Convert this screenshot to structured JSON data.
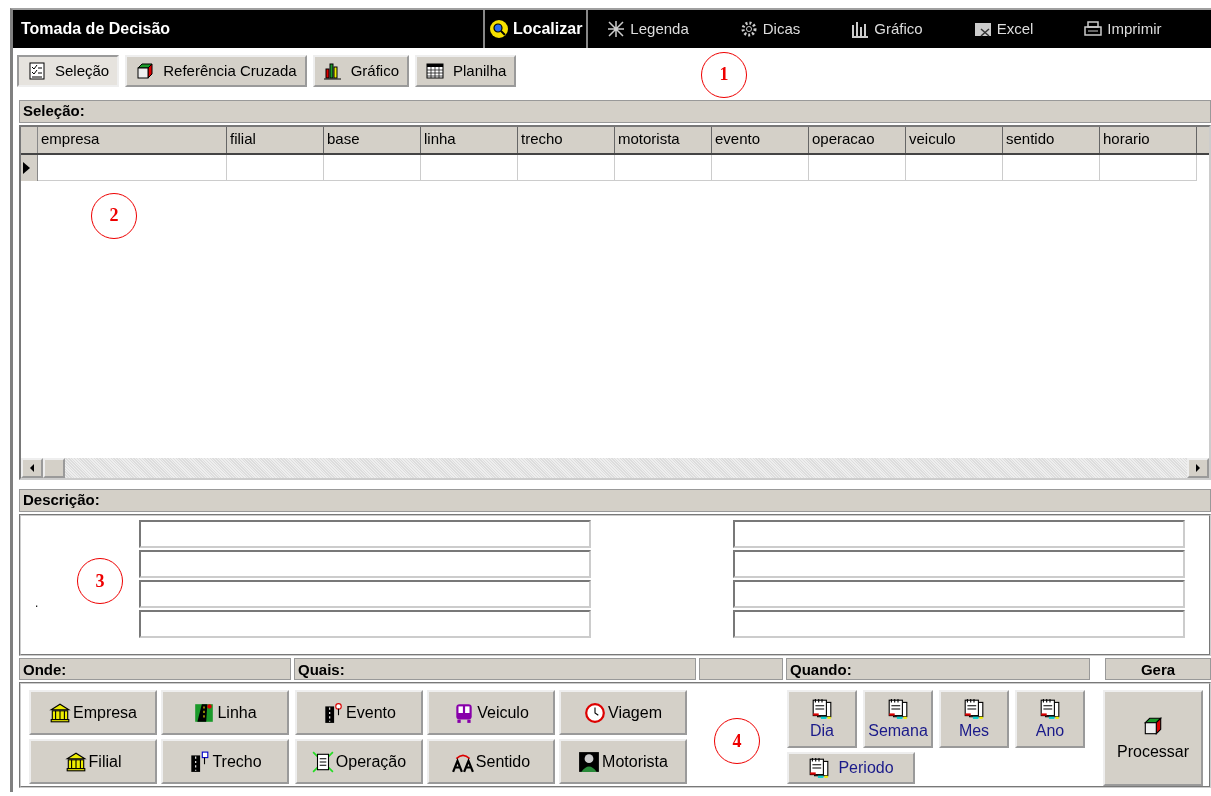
{
  "window": {
    "title": "Tomada de Decisão"
  },
  "search_button": {
    "label": "Localizar",
    "kind": "search"
  },
  "top_menu": [
    {
      "label": "Legenda",
      "kind": "legend"
    },
    {
      "label": "Dicas",
      "kind": "gear"
    },
    {
      "label": "Gráfico",
      "kind": "bars"
    },
    {
      "label": "Excel",
      "kind": "sheet"
    },
    {
      "label": "Imprimir",
      "kind": "printer"
    }
  ],
  "tabs": [
    {
      "label": "Seleção",
      "kind": "checklist",
      "selected": true
    },
    {
      "label": "Referência Cruzada",
      "kind": "cube",
      "selected": false
    },
    {
      "label": "Gráfico",
      "kind": "colorbars",
      "selected": false
    },
    {
      "label": "Planilha",
      "kind": "grid",
      "selected": false
    }
  ],
  "selection": {
    "title": "Seleção:",
    "columns": [
      "empresa",
      "filial",
      "base",
      "linha",
      "trecho",
      "motorista",
      "evento",
      "operacao",
      "veiculo",
      "sentido",
      "horario"
    ]
  },
  "description": {
    "title": "Descrição:",
    "marker": "."
  },
  "sections": [
    {
      "title": "Onde:"
    },
    {
      "title": "Quais:"
    },
    {
      "title": "Quando:"
    },
    {
      "title": "Gera"
    }
  ],
  "onde_buttons": [
    {
      "label": "Empresa",
      "kind": "bank"
    },
    {
      "label": "Linha",
      "kind": "road"
    },
    {
      "label": "Filial",
      "kind": "bank"
    },
    {
      "label": "Trecho",
      "kind": "road-flag"
    }
  ],
  "quais_buttons": [
    {
      "label": "Evento",
      "kind": "road-pin"
    },
    {
      "label": "Veiculo",
      "kind": "bus"
    },
    {
      "label": "Viagem",
      "kind": "clock"
    },
    {
      "label": "Operação",
      "kind": "document"
    },
    {
      "label": "Sentido",
      "kind": "letters"
    },
    {
      "label": "Motorista",
      "kind": "person"
    }
  ],
  "quando_buttons": [
    {
      "label": "Dia"
    },
    {
      "label": "Semana"
    },
    {
      "label": "Mes"
    },
    {
      "label": "Ano"
    },
    {
      "label": "Periodo"
    }
  ],
  "process_button": {
    "label": "Processar"
  },
  "annotations": [
    "1",
    "2",
    "3",
    "4"
  ]
}
